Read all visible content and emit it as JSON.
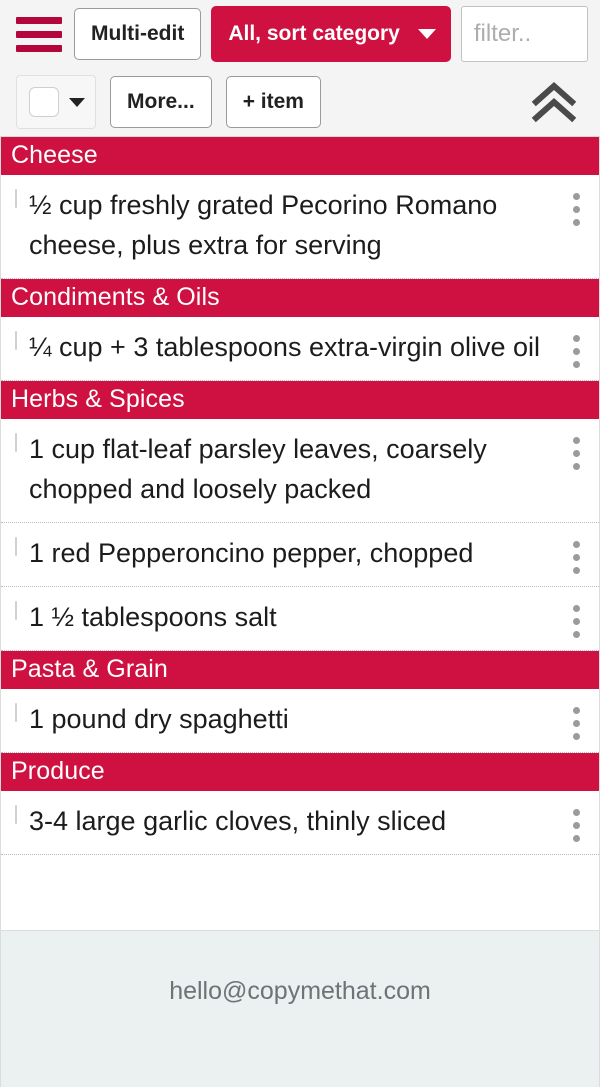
{
  "toolbar": {
    "menu_icon": "hamburger-icon",
    "multi_edit_label": "Multi-edit",
    "sort_label": "All, sort category",
    "sort_caret_icon": "chevron-down-icon",
    "filter_placeholder": "filter..",
    "filter_value": "",
    "select_all_caret_icon": "chevron-down-icon",
    "more_label": "More...",
    "add_item_label": "+ item",
    "collapse_icon": "double-chevron-up-icon"
  },
  "colors": {
    "brand_red": "#ce1141",
    "hamburger_red": "#b3063c",
    "toolbar_bg": "#f4f4f4",
    "footer_bg": "#ebf0f0",
    "text": "#1c1c1c",
    "kebab_gray": "#9b9b9b"
  },
  "list": {
    "categories": [
      {
        "name": "Cheese",
        "items": [
          {
            "text": "½ cup freshly grated Pecorino Romano cheese, plus extra for serving",
            "checked": false
          }
        ]
      },
      {
        "name": "Condiments & Oils",
        "items": [
          {
            "text": "¼ cup + 3 tablespoons extra-virgin olive oil",
            "checked": false
          }
        ]
      },
      {
        "name": "Herbs & Spices",
        "items": [
          {
            "text": "1 cup flat-leaf parsley leaves, coarsely chopped and loosely packed",
            "checked": false
          },
          {
            "text": "1 red Pepperoncino pepper, chopped",
            "checked": false
          },
          {
            "text": "1 ½ tablespoons salt",
            "checked": false
          }
        ]
      },
      {
        "name": "Pasta & Grain",
        "items": [
          {
            "text": "1 pound dry spaghetti",
            "checked": false
          }
        ]
      },
      {
        "name": "Produce",
        "items": [
          {
            "text": "3-4 large garlic cloves, thinly sliced",
            "checked": false
          }
        ]
      }
    ]
  },
  "footer": {
    "email": "hello@copymethat.com"
  }
}
